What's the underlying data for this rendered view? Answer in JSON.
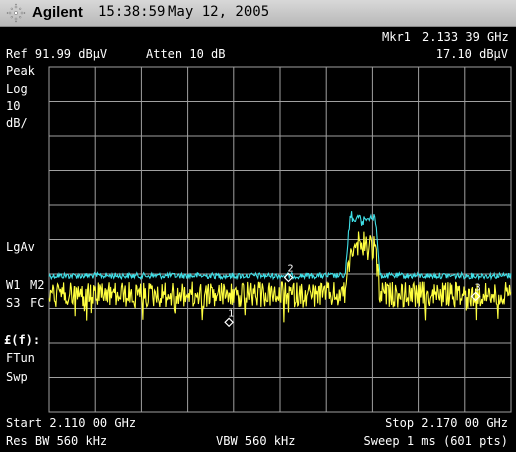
{
  "titlebar": {
    "brand": "Agilent",
    "time": "15:38:59",
    "date": "May 12, 2005"
  },
  "header": {
    "marker_readout_label": "Mkr1",
    "marker_freq": "2.133 39 GHz",
    "ref_level": "Ref 91.99 dBμV",
    "atten": "Atten 10 dB",
    "marker_ampl": "17.10 dBμV"
  },
  "left_annotations": {
    "detector": "Peak",
    "scale_type": "Log",
    "scale_value": "10",
    "scale_unit": "dB/",
    "averaging": "LgAv",
    "w1": "W1",
    "m2": "M2",
    "s3": "S3",
    "fc": "FC",
    "ff": "£(f):",
    "ftun": "FTun",
    "swp": "Swp"
  },
  "footer": {
    "start": "Start 2.110 00 GHz",
    "stop": "Stop 2.170 00 GHz",
    "rbw": "Res BW 560 kHz",
    "vbw": "VBW 560 kHz",
    "sweep": "Sweep 1 ms (601 pts)"
  },
  "markers": [
    {
      "label": "1",
      "freq_ghz": 2.13339,
      "level_div": 7.4
    },
    {
      "label": "2",
      "freq_ghz": 2.1411,
      "level_div": 6.1
    },
    {
      "label": "3",
      "freq_ghz": 2.1654,
      "level_div": 6.65
    }
  ],
  "chart_data": {
    "type": "line",
    "x_range_ghz": [
      2.11,
      2.17
    ],
    "y_divisions": 10,
    "grid": true,
    "series": [
      {
        "color": "#40e0e8",
        "noise_floor_div": 6.05,
        "signal_top_div": 4.4,
        "signal_band_ghz": [
          2.1485,
          2.153
        ]
      },
      {
        "color": "#ffff40",
        "noise_floor_div": 6.6,
        "signal_top_div": 5.2,
        "signal_band_ghz": [
          2.1485,
          2.153
        ]
      }
    ],
    "colors": {
      "grid": "#a0a0a0",
      "text": "#ffffff",
      "marker": "#ffffff"
    }
  }
}
